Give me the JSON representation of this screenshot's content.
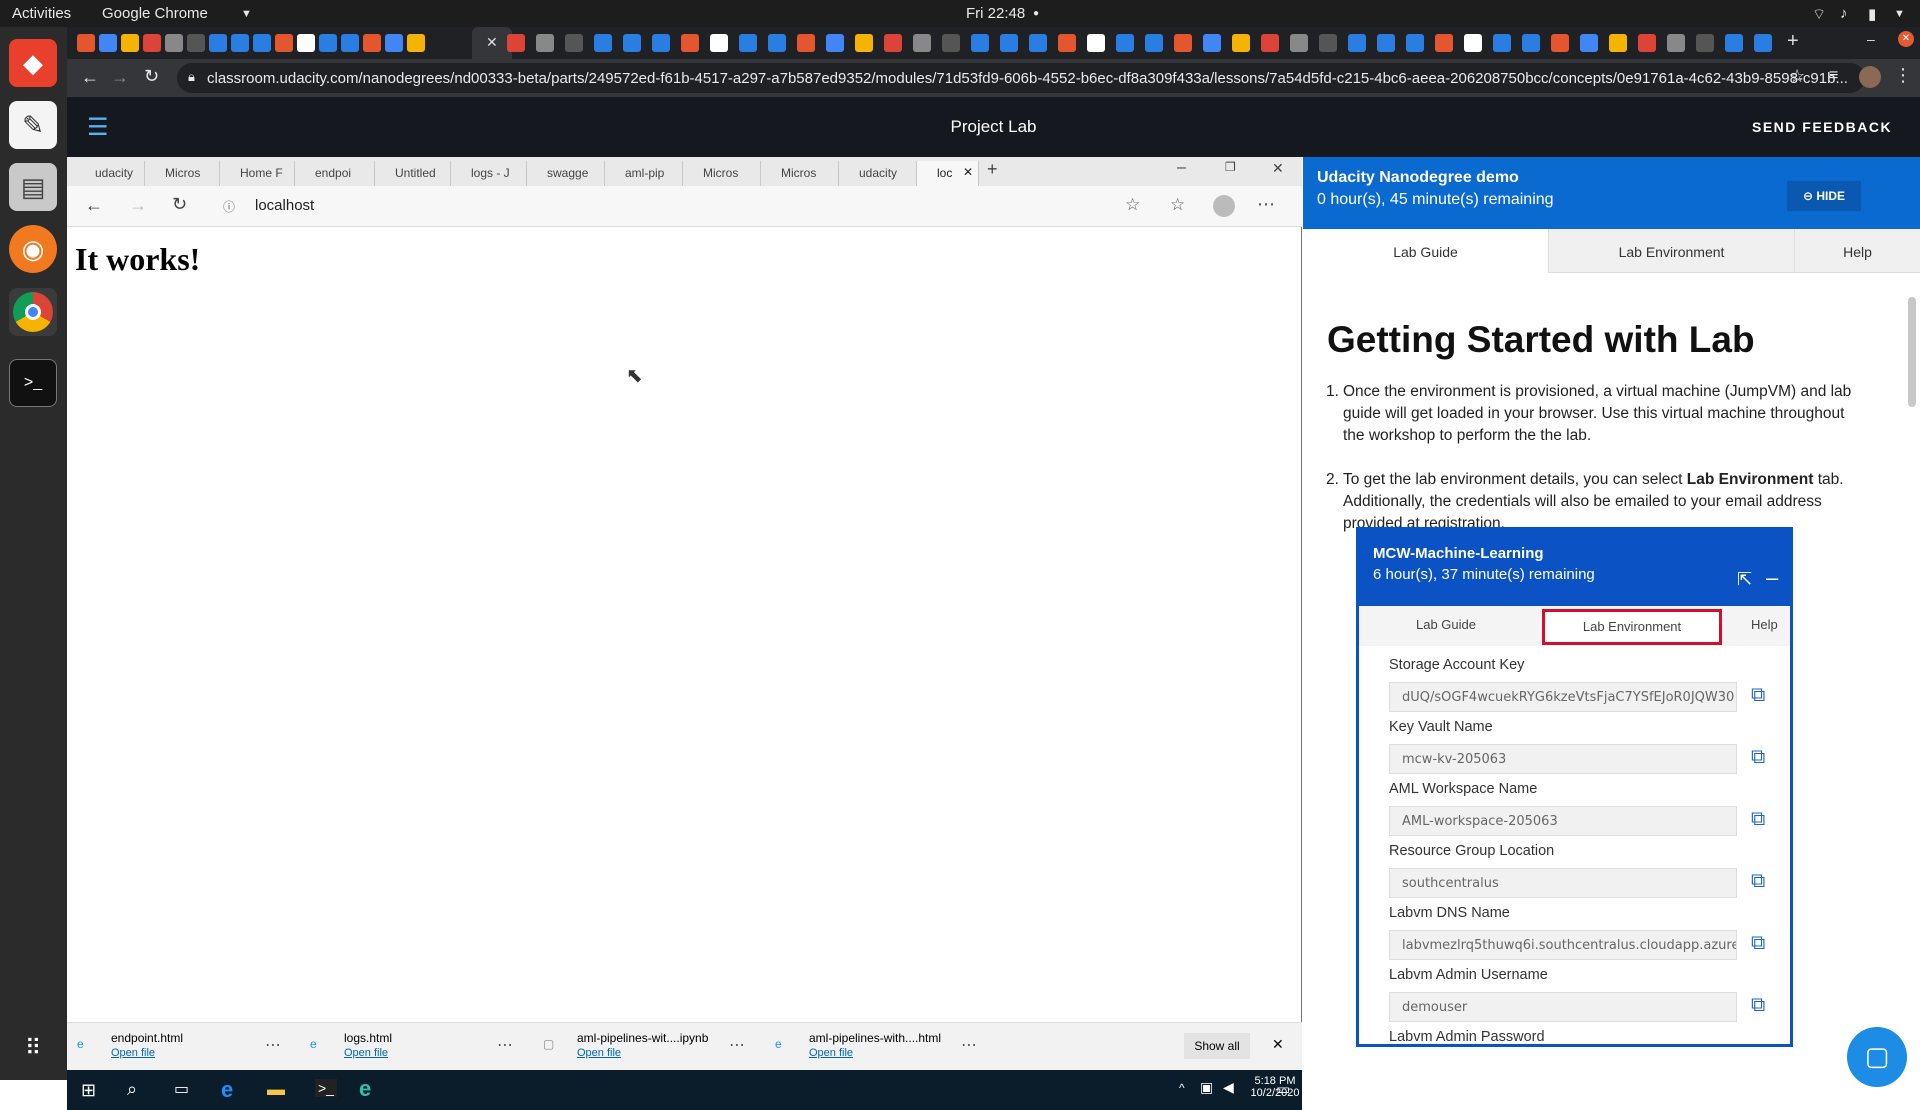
{
  "os": {
    "activities": "Activities",
    "app_name": "Google Chrome",
    "clock": "Fri 22:48"
  },
  "browser": {
    "url": "classroom.udacity.com/nanodegrees/nd00333-beta/parts/249572ed-f61b-4517-a297-a7b587ed9352/modules/71d53fd9-606b-4552-b6ec-df8a309f433a/lessons/7a54d5fd-c215-4bc6-aeea-206208750bcc/concepts/0e91761a-4c62-43b9-8598-c91b..."
  },
  "site": {
    "title": "Project Lab",
    "feedback": "SEND FEEDBACK"
  },
  "vm": {
    "tabs": [
      "udacity",
      "Micros",
      "Home F",
      "endpoi",
      "Untitled",
      "logs - J",
      "swagge",
      "aml-pip",
      "Micros",
      "Micros",
      "udacity",
      "loc"
    ],
    "address": "localhost",
    "page_heading": "It works!",
    "downloads": [
      {
        "name": "endpoint.html",
        "action": "Open file"
      },
      {
        "name": "logs.html",
        "action": "Open file"
      },
      {
        "name": "aml-pipelines-wit....ipynb",
        "action": "Open file"
      },
      {
        "name": "aml-pipelines-with....html",
        "action": "Open file"
      }
    ],
    "show_all": "Show all",
    "tray_time": "5:18 PM",
    "tray_date": "10/2/2020"
  },
  "panel": {
    "title": "Udacity Nanodegree demo",
    "remaining": "0 hour(s), 45 minute(s) remaining",
    "hide_label": "HIDE",
    "tabs": [
      "Lab Guide",
      "Lab Environment",
      "Help"
    ],
    "heading": "Getting Started with Lab",
    "steps": [
      {
        "num": "1.",
        "text": "Once the environment is provisioned, a virtual machine (JumpVM) and lab guide will get loaded in your browser. Use this virtual machine throughout the workshop to perform the the lab."
      },
      {
        "num": "2.",
        "pre": "To get the lab environment details, you can select ",
        "bold": "Lab Environment",
        "post": " tab. Additionally, the credentials will also be emailed to your email address provided at registration."
      }
    ],
    "shot": {
      "title": "MCW-Machine-Learning",
      "remaining": "6 hour(s), 37 minute(s) remaining",
      "tabs": [
        "Lab Guide",
        "Lab Environment",
        "Help"
      ],
      "fields": [
        {
          "label": "Storage Account Key",
          "value": "dUQ/sOGF4wcuekRYG6kzeVtsFjaC7YSfEJoR0JQW30"
        },
        {
          "label": "Key Vault Name",
          "value": "mcw-kv-205063"
        },
        {
          "label": "AML Workspace Name",
          "value": "AML-workspace-205063"
        },
        {
          "label": "Resource Group Location",
          "value": "southcentralus"
        },
        {
          "label": "Labvm DNS Name",
          "value": "labvmezlrq5thuwq6i.southcentralus.cloudapp.azure."
        },
        {
          "label": "Labvm Admin Username",
          "value": "demouser"
        },
        {
          "label": "Labvm Admin Password",
          "value": ""
        }
      ]
    }
  },
  "colors": {
    "site_bg": "#16181f",
    "panel_blue": "#0b6ad0",
    "highlight": "#d0102e",
    "link": "#0067b8"
  }
}
